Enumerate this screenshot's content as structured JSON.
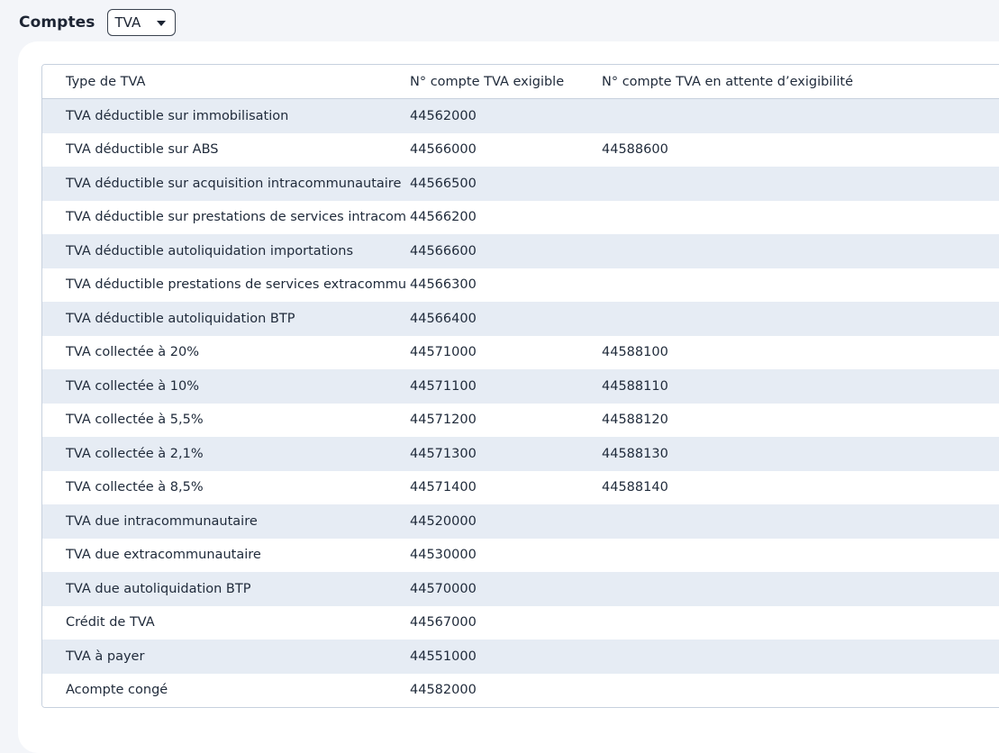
{
  "header": {
    "title": "Comptes",
    "select_value": "TVA"
  },
  "table": {
    "columns": [
      "Type de TVA",
      "N° compte TVA exigible",
      "N° compte TVA en attente d’exigibilité"
    ],
    "rows": [
      [
        "TVA déductible sur immobilisation",
        "44562000",
        ""
      ],
      [
        "TVA déductible sur ABS",
        "44566000",
        "44588600"
      ],
      [
        "TVA déductible sur acquisition intracommunautaire",
        "44566500",
        ""
      ],
      [
        "TVA déductible sur prestations de services intracom",
        "44566200",
        ""
      ],
      [
        "TVA déductible autoliquidation importations",
        "44566600",
        ""
      ],
      [
        "TVA déductible prestations de services extracommu",
        "44566300",
        ""
      ],
      [
        "TVA déductible autoliquidation BTP",
        "44566400",
        ""
      ],
      [
        "TVA collectée à 20%",
        "44571000",
        "44588100"
      ],
      [
        "TVA collectée à 10%",
        "44571100",
        "44588110"
      ],
      [
        "TVA collectée à 5,5%",
        "44571200",
        "44588120"
      ],
      [
        "TVA collectée à 2,1%",
        "44571300",
        "44588130"
      ],
      [
        "TVA collectée à 8,5%",
        "44571400",
        "44588140"
      ],
      [
        "TVA due intracommunautaire",
        "44520000",
        ""
      ],
      [
        "TVA due extracommunautaire",
        "44530000",
        ""
      ],
      [
        "TVA due autoliquidation BTP",
        "44570000",
        ""
      ],
      [
        "Crédit de TVA",
        "44567000",
        ""
      ],
      [
        "TVA à payer",
        "44551000",
        ""
      ],
      [
        "Acompte congé",
        "44582000",
        ""
      ]
    ]
  }
}
